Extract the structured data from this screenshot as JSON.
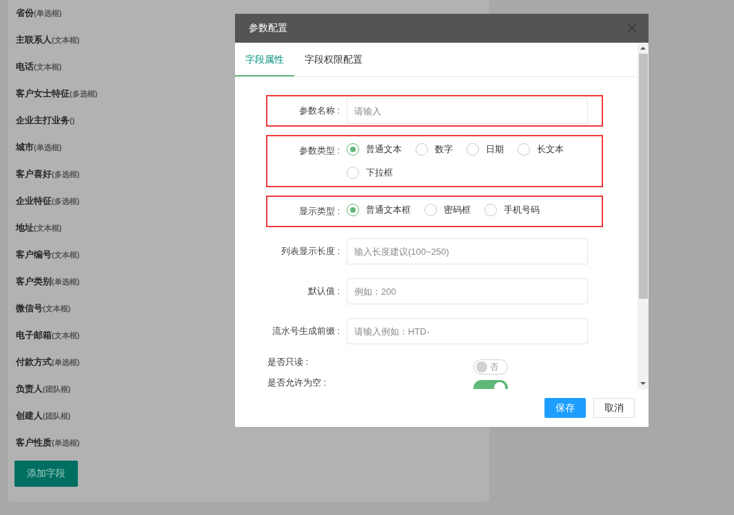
{
  "field_list": {
    "items": [
      {
        "name": "省份",
        "type": "(单选框)"
      },
      {
        "name": "主联系人",
        "type": "(文本框)"
      },
      {
        "name": "电话",
        "type": "(文本框)"
      },
      {
        "name": "客户女士特征",
        "type": "(多选框)"
      },
      {
        "name": "企业主打业务",
        "type": "()"
      },
      {
        "name": "城市",
        "type": "(单选框)"
      },
      {
        "name": "客户喜好",
        "type": "(多选框)"
      },
      {
        "name": "企业特征",
        "type": "(多选框)"
      },
      {
        "name": "地址",
        "type": "(文本框)"
      },
      {
        "name": "客户编号",
        "type": "(文本框)"
      },
      {
        "name": "客户类别",
        "type": "(单选框)"
      },
      {
        "name": "微信号",
        "type": "(文本框)"
      },
      {
        "name": "电子邮箱",
        "type": "(文本框)"
      },
      {
        "name": "付款方式",
        "type": "(单选框)"
      },
      {
        "name": "负责人",
        "type": "(团队框)"
      },
      {
        "name": "创建人",
        "type": "(团队框)"
      },
      {
        "name": "客户性质",
        "type": "(单选框)"
      }
    ],
    "add_button": "添加字段"
  },
  "dialog": {
    "title": "参数配置",
    "tabs": [
      {
        "label": "字段属性",
        "selected": true
      },
      {
        "label": "字段权限配置",
        "selected": false
      }
    ],
    "form": [
      {
        "kind": "input",
        "label": "参数名称 :",
        "placeholder": "请输入",
        "highlighted": true
      },
      {
        "kind": "radio",
        "label": "参数类型 :",
        "highlighted": true,
        "options": [
          {
            "label": "普通文本",
            "selected": true
          },
          {
            "label": "数字",
            "selected": false
          },
          {
            "label": "日期",
            "selected": false
          },
          {
            "label": "长文本",
            "selected": false
          },
          {
            "label": "下拉框",
            "selected": false
          }
        ]
      },
      {
        "kind": "radio",
        "label": "显示类型 :",
        "highlighted": true,
        "options": [
          {
            "label": "普通文本框",
            "selected": true
          },
          {
            "label": "密码框",
            "selected": false
          },
          {
            "label": "手机号码",
            "selected": false
          }
        ]
      },
      {
        "kind": "input",
        "label": "列表显示长度 :",
        "placeholder": "输入长度建议(100~250)",
        "highlighted": false
      },
      {
        "kind": "input",
        "label": "默认值 :",
        "placeholder": "例如：200",
        "highlighted": false
      },
      {
        "kind": "input",
        "label": "流水号生成前缀 :",
        "placeholder": "请输入例如：HTD-",
        "highlighted": false
      },
      {
        "kind": "toggle",
        "label": "是否只读 :",
        "on": false,
        "toggle_text": "否"
      },
      {
        "kind": "toggle",
        "label": "是否允许为空 :",
        "on": true
      }
    ],
    "buttons": [
      {
        "label": "保存",
        "kind": "primary"
      },
      {
        "label": "取消",
        "kind": "default"
      }
    ]
  }
}
